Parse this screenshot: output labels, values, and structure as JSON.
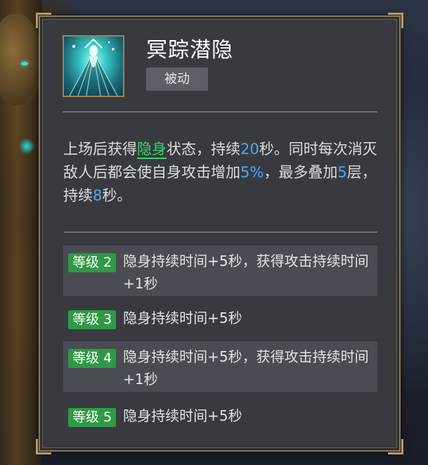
{
  "skill": {
    "name": "冥踪潜隐",
    "type": "被动",
    "icon": "stealth-spirit-icon"
  },
  "description": {
    "part1": "上场后获得",
    "stealth": "隐身",
    "part2": "状态，持续",
    "duration": "20",
    "part3": "秒。同时每次消灭敌人后都会使自身攻击增加",
    "attack_bonus": "5%",
    "part4": "，最多叠加",
    "max_stacks": "5",
    "part5": "层，持续",
    "stack_duration": "8",
    "part6": "秒。"
  },
  "levels": [
    {
      "label": "等级 2",
      "text": "隐身持续时间+5秒，获得攻击持续时间+1秒"
    },
    {
      "label": "等级 3",
      "text": "隐身持续时间+5秒"
    },
    {
      "label": "等级 4",
      "text": "隐身持续时间+5秒，获得攻击持续时间+1秒"
    },
    {
      "label": "等级 5",
      "text": "隐身持续时间+5秒"
    }
  ],
  "colors": {
    "highlight_green": "#36d66a",
    "highlight_blue": "#4aa8ff",
    "level_badge": "#2f9a45",
    "panel_bg": "#383a40",
    "frame_gold": "#b59a66"
  }
}
